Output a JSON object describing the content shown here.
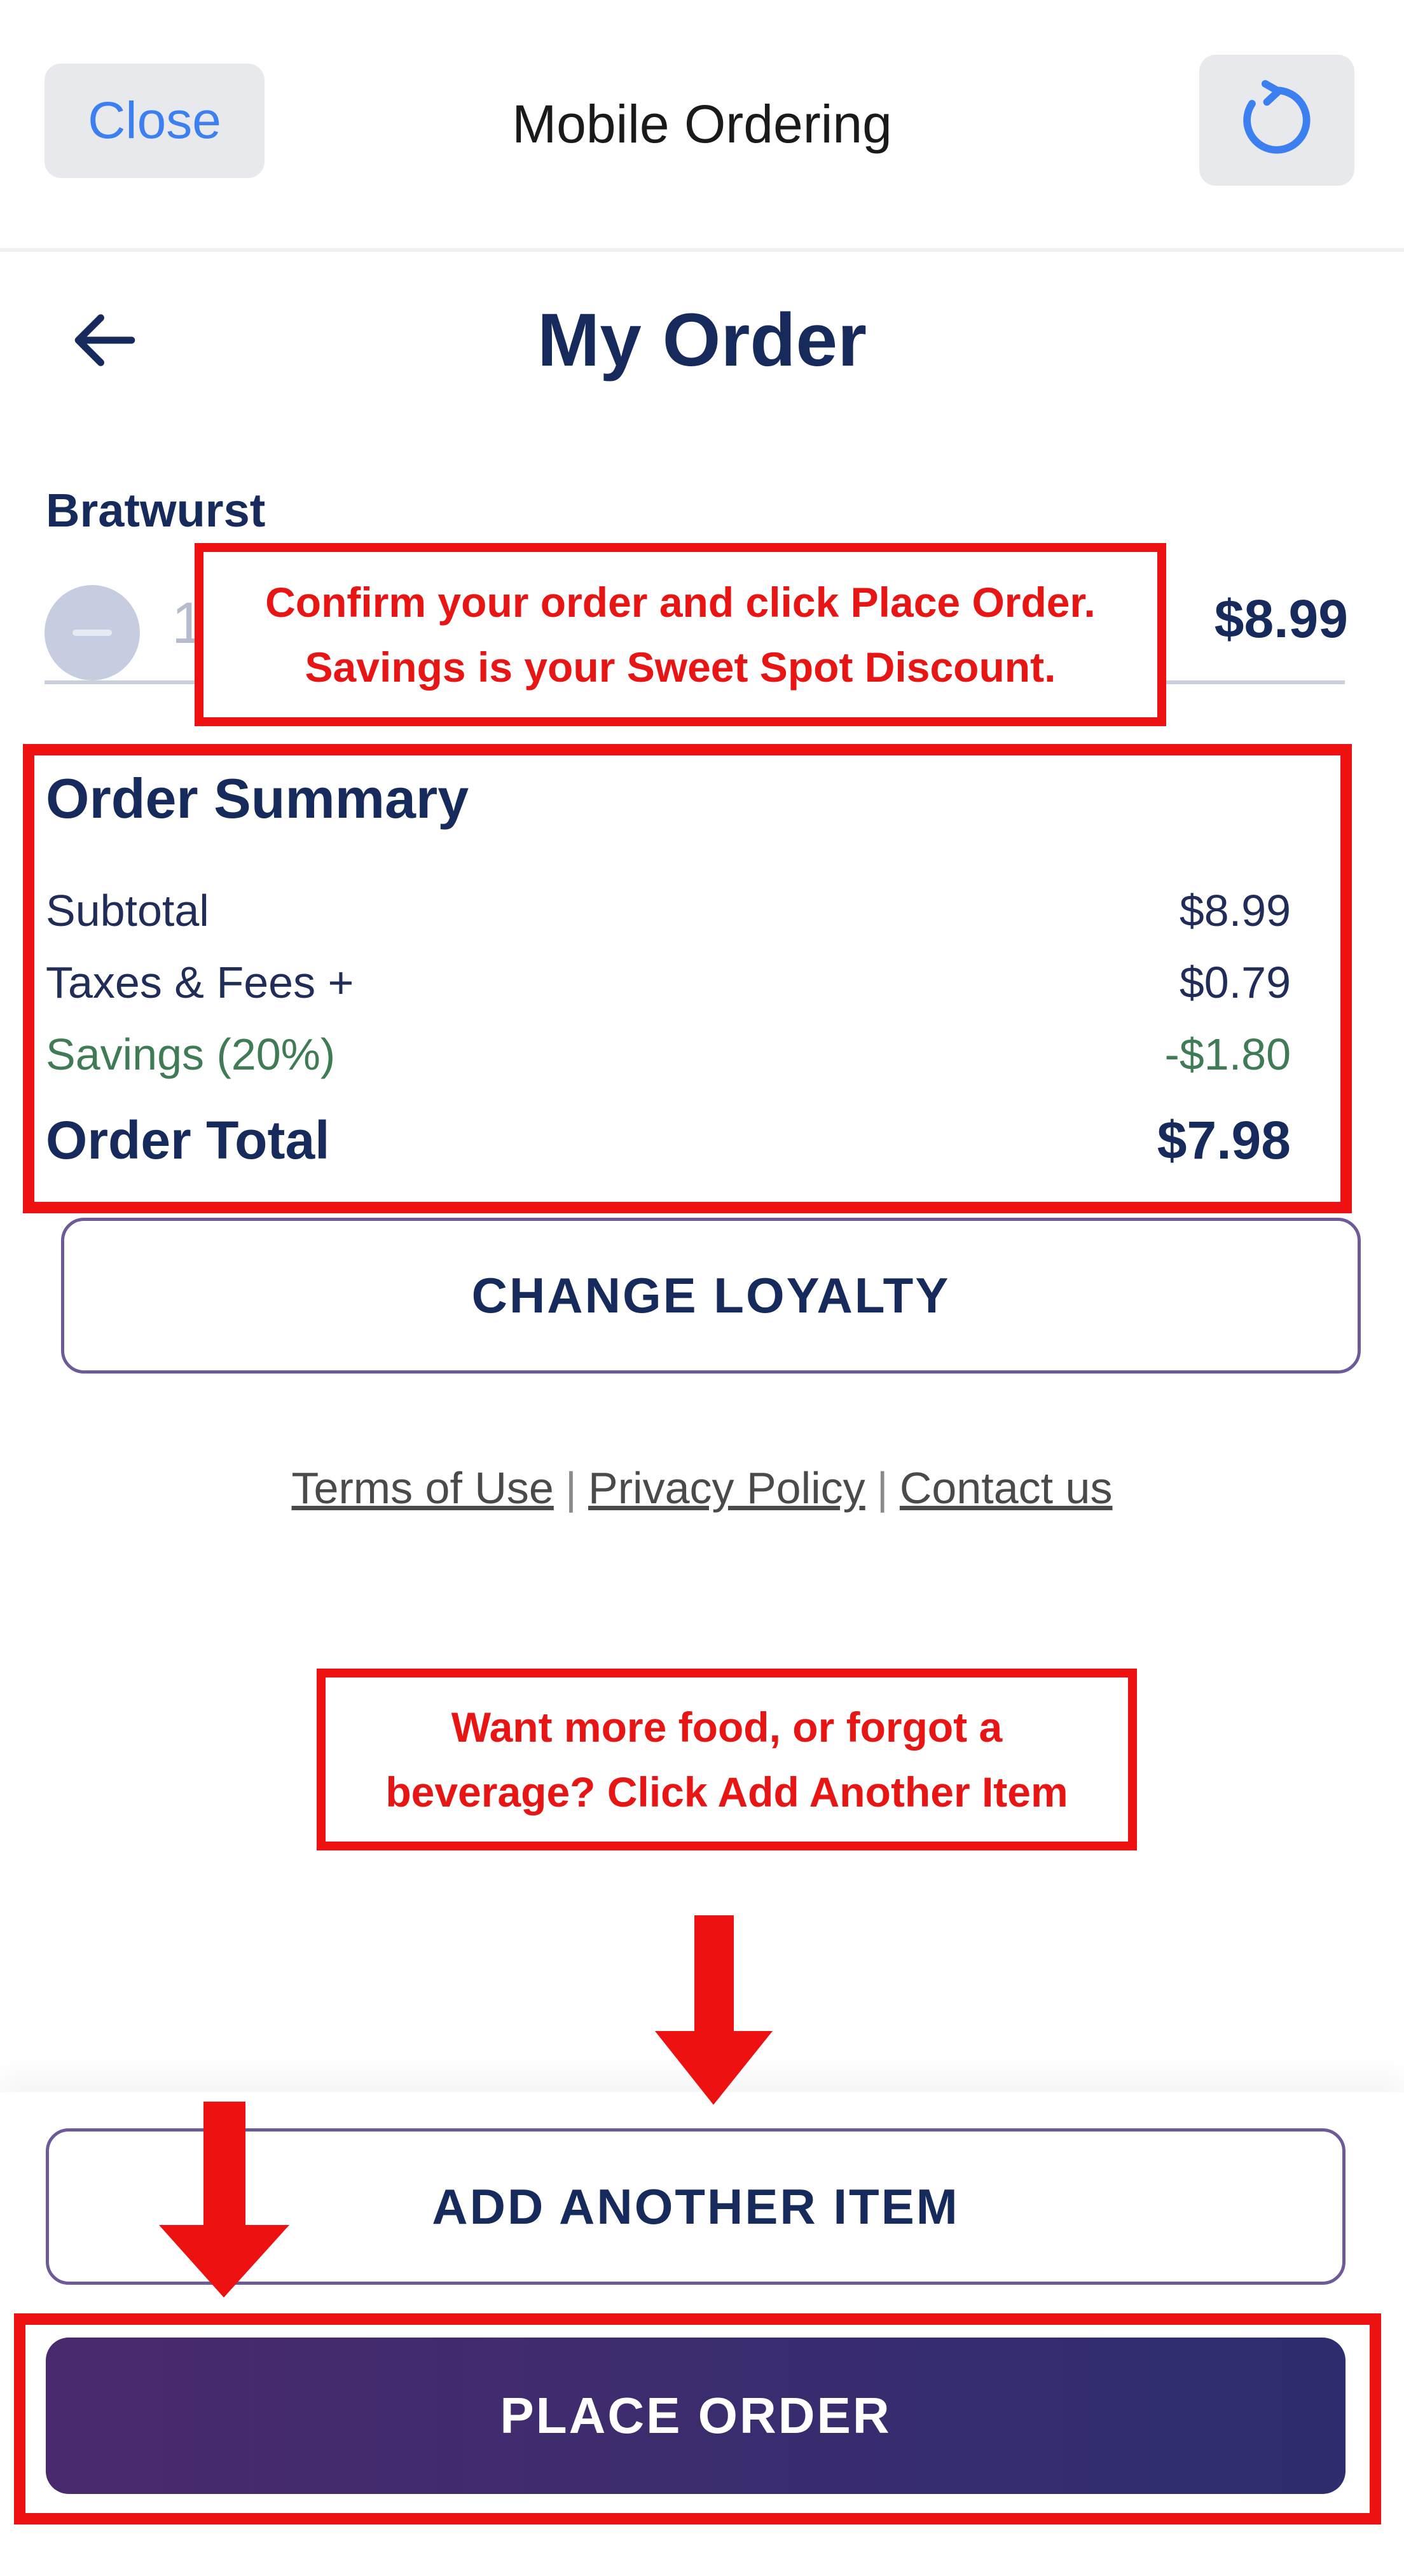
{
  "topbar": {
    "close_label": "Close",
    "title": "Mobile Ordering"
  },
  "header": {
    "title": "My Order"
  },
  "item": {
    "name": "Bratwurst",
    "quantity_peek": "1",
    "price": "$8.99"
  },
  "callouts": {
    "top_line1": "Confirm your order and click Place Order.",
    "top_line2": "Savings is your Sweet Spot Discount.",
    "mid_line1": "Want more food, or forgot a",
    "mid_line2": "beverage? Click Add Another Item"
  },
  "summary": {
    "heading": "Order Summary",
    "rows": [
      {
        "label": "Subtotal",
        "value": "$8.99"
      },
      {
        "label": "Taxes & Fees +",
        "value": "$0.79"
      },
      {
        "label": "Savings (20%)",
        "value": "-$1.80"
      },
      {
        "label": "Order Total",
        "value": "$7.98"
      }
    ]
  },
  "buttons": {
    "change_loyalty": "CHANGE LOYALTY",
    "add_another": "ADD ANOTHER ITEM",
    "place_order": "PLACE ORDER"
  },
  "footer": {
    "terms": "Terms of Use",
    "privacy": "Privacy Policy",
    "contact": "Contact us",
    "separator": "|"
  },
  "colors": {
    "annotation_red": "#ee1111",
    "navy": "#172a5c",
    "savings_green": "#3f7c56",
    "ios_blue": "#3c7ff0",
    "button_purple": "#4a2a6e"
  }
}
